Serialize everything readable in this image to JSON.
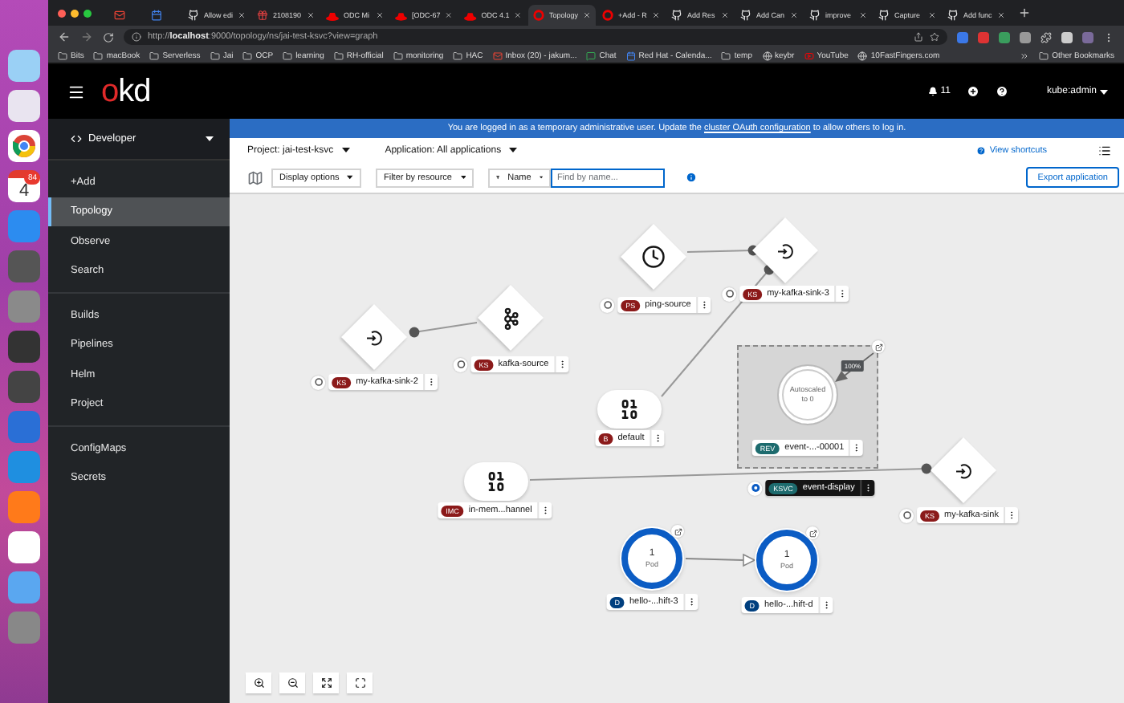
{
  "dock": {
    "calendar": {
      "day": "4",
      "badge": "84"
    }
  },
  "browser": {
    "tabs": [
      {
        "kind": "mail",
        "selected": false
      },
      {
        "kind": "calendar",
        "selected": false
      },
      {
        "kind": "github",
        "title": "Allow edi",
        "selected": false
      },
      {
        "kind": "gift",
        "title": "2108190",
        "selected": false
      },
      {
        "kind": "redhat",
        "title": "ODC Mi",
        "selected": false
      },
      {
        "kind": "redhat",
        "title": "[ODC-67",
        "selected": false
      },
      {
        "kind": "redhat",
        "title": "ODC 4.1",
        "selected": false
      },
      {
        "kind": "openshift",
        "title": "Topology",
        "selected": true
      },
      {
        "kind": "openshift",
        "title": "+Add - R",
        "selected": false
      },
      {
        "kind": "github",
        "title": "Add Res",
        "selected": false
      },
      {
        "kind": "github",
        "title": "Add Can",
        "selected": false
      },
      {
        "kind": "github",
        "title": "improve",
        "selected": false
      },
      {
        "kind": "github",
        "title": "Capture",
        "selected": false
      },
      {
        "kind": "github",
        "title": "Add func",
        "selected": false
      }
    ],
    "url": "http://**localhost**:9000/topology/ns/jai-test-ksvc?view=graph",
    "bookmarks": [
      {
        "kind": "folder",
        "label": "Bits"
      },
      {
        "kind": "folder",
        "label": "macBook"
      },
      {
        "kind": "folder",
        "label": "Serverless"
      },
      {
        "kind": "folder",
        "label": "Jai"
      },
      {
        "kind": "folder",
        "label": "OCP"
      },
      {
        "kind": "folder",
        "label": "learning"
      },
      {
        "kind": "folder",
        "label": "RH-official"
      },
      {
        "kind": "folder",
        "label": "monitoring"
      },
      {
        "kind": "folder",
        "label": "HAC"
      },
      {
        "kind": "mail",
        "label": "Inbox (20) - jakum..."
      },
      {
        "kind": "chat",
        "label": "Chat"
      },
      {
        "kind": "calendar",
        "label": "Red Hat - Calenda..."
      },
      {
        "kind": "folder",
        "label": "temp"
      },
      {
        "kind": "site",
        "label": "keybr"
      },
      {
        "kind": "video",
        "label": "YouTube"
      },
      {
        "kind": "site",
        "label": "10FastFingers.com"
      }
    ],
    "other_bookmarks": "Other Bookmarks"
  },
  "header": {
    "logo": "okd",
    "notifications": "11",
    "user": "kube:admin"
  },
  "perspective": "Developer",
  "nav_groups": [
    {
      "items": [
        {
          "label": "+Add",
          "selected": false
        },
        {
          "label": "Topology",
          "selected": true
        },
        {
          "label": "Observe",
          "selected": false
        },
        {
          "label": "Search",
          "selected": false
        }
      ]
    },
    {
      "items": [
        {
          "label": "Builds",
          "selected": false
        },
        {
          "label": "Pipelines",
          "selected": false
        },
        {
          "label": "Helm",
          "selected": false
        },
        {
          "label": "Project",
          "selected": false
        }
      ]
    },
    {
      "items": [
        {
          "label": "ConfigMaps",
          "selected": false
        },
        {
          "label": "Secrets",
          "selected": false
        }
      ]
    }
  ],
  "banner": {
    "text_before": "You are logged in as a temporary administrative user. Update the",
    "link": "cluster OAuth configuration",
    "text_after": "to allow others to log in."
  },
  "project_bar": {
    "project": "Project: jai-test-ksvc",
    "application": "Application: All applications",
    "shortcuts": "View shortcuts"
  },
  "toolbar": {
    "display_options": "Display options",
    "filter": "Filter by resource",
    "filter_type": "Name",
    "search_placeholder": "Find by name...",
    "export": "Export application"
  },
  "nodes": [
    {
      "kind": "ping",
      "badge": "PS",
      "color": "#8b1a1a",
      "name": "ping-source"
    },
    {
      "kind": "sink",
      "badge": "KS",
      "color": "#8b1a1a",
      "name": "my-kafka-sink-3"
    },
    {
      "kind": "sink",
      "badge": "KS",
      "color": "#8b1a1a",
      "name": "my-kafka-sink-2"
    },
    {
      "kind": "kafka",
      "badge": "KS",
      "color": "#8b1a1a",
      "name": "kafka-source"
    },
    {
      "kind": "channel",
      "badge": "B",
      "color": "#8b1a1a",
      "name": "default"
    },
    {
      "kind": "revision",
      "badge": "REV",
      "color": "#1d6b6e",
      "name": "event-...-00001",
      "status": "Autoscaled",
      "status_detail": "to 0",
      "traffic": "100%"
    },
    {
      "kind": "service",
      "badge": "KSVC",
      "color": "#1d6b6e",
      "name": "event-display"
    },
    {
      "kind": "sink",
      "badge": "KS",
      "color": "#8b1a1a",
      "name": "my-kafka-sink"
    },
    {
      "kind": "channel",
      "badge": "IMC",
      "color": "#8b1a1a",
      "name": "in-mem...hannel"
    },
    {
      "kind": "deployment",
      "badge": "D",
      "color": "#003f7f",
      "name": "hello-...hift-3",
      "count": "1",
      "unit": "Pod"
    },
    {
      "kind": "deployment",
      "badge": "D",
      "color": "#003f7f",
      "name": "hello-...hift-d",
      "count": "1",
      "unit": "Pod"
    }
  ]
}
